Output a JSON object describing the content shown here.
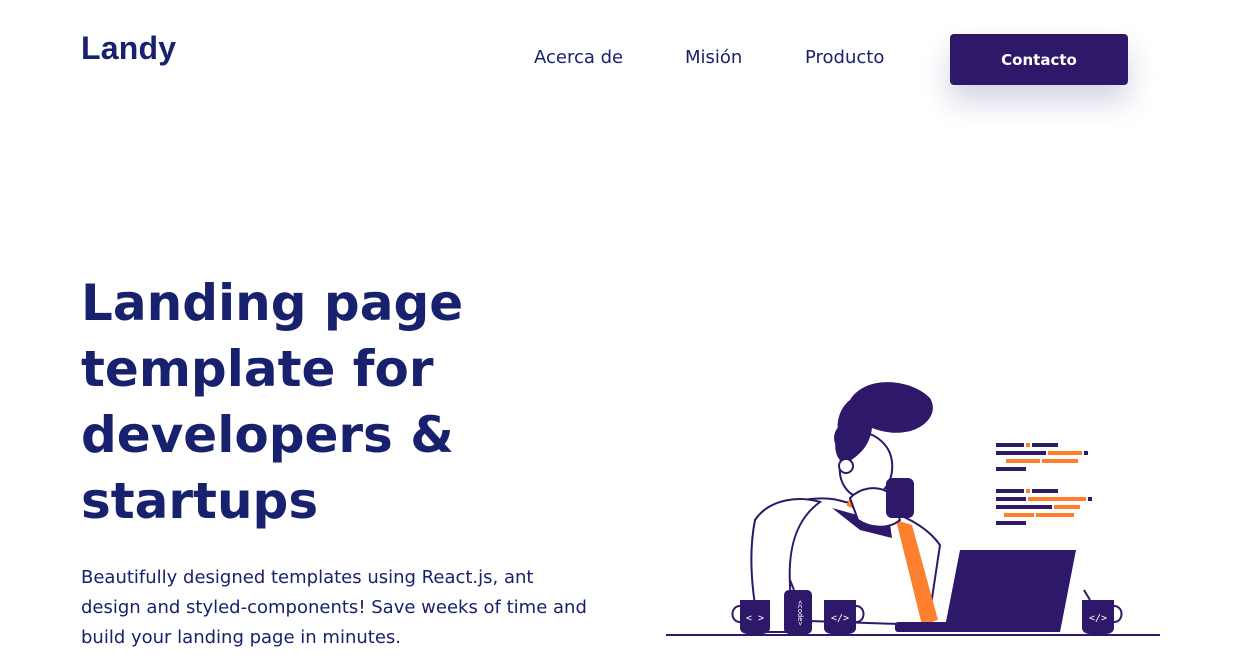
{
  "header": {
    "logo": "Landy",
    "nav": [
      "Acerca de",
      "Misión",
      "Producto"
    ],
    "contact_label": "Contacto"
  },
  "hero": {
    "title_lines": [
      "Landing page",
      "template for",
      "developers &",
      "startups"
    ],
    "description": "Beautifully designed templates using React.js, ant design and styled-components! Save weeks of time and build your landing page in minutes."
  },
  "illustration": {
    "mug_labels": [
      "< >",
      "</>",
      "</>"
    ],
    "can_label": "<code>"
  },
  "colors": {
    "primary": "#18216d",
    "button": "#2e186a",
    "accent": "#fe7f2d"
  }
}
